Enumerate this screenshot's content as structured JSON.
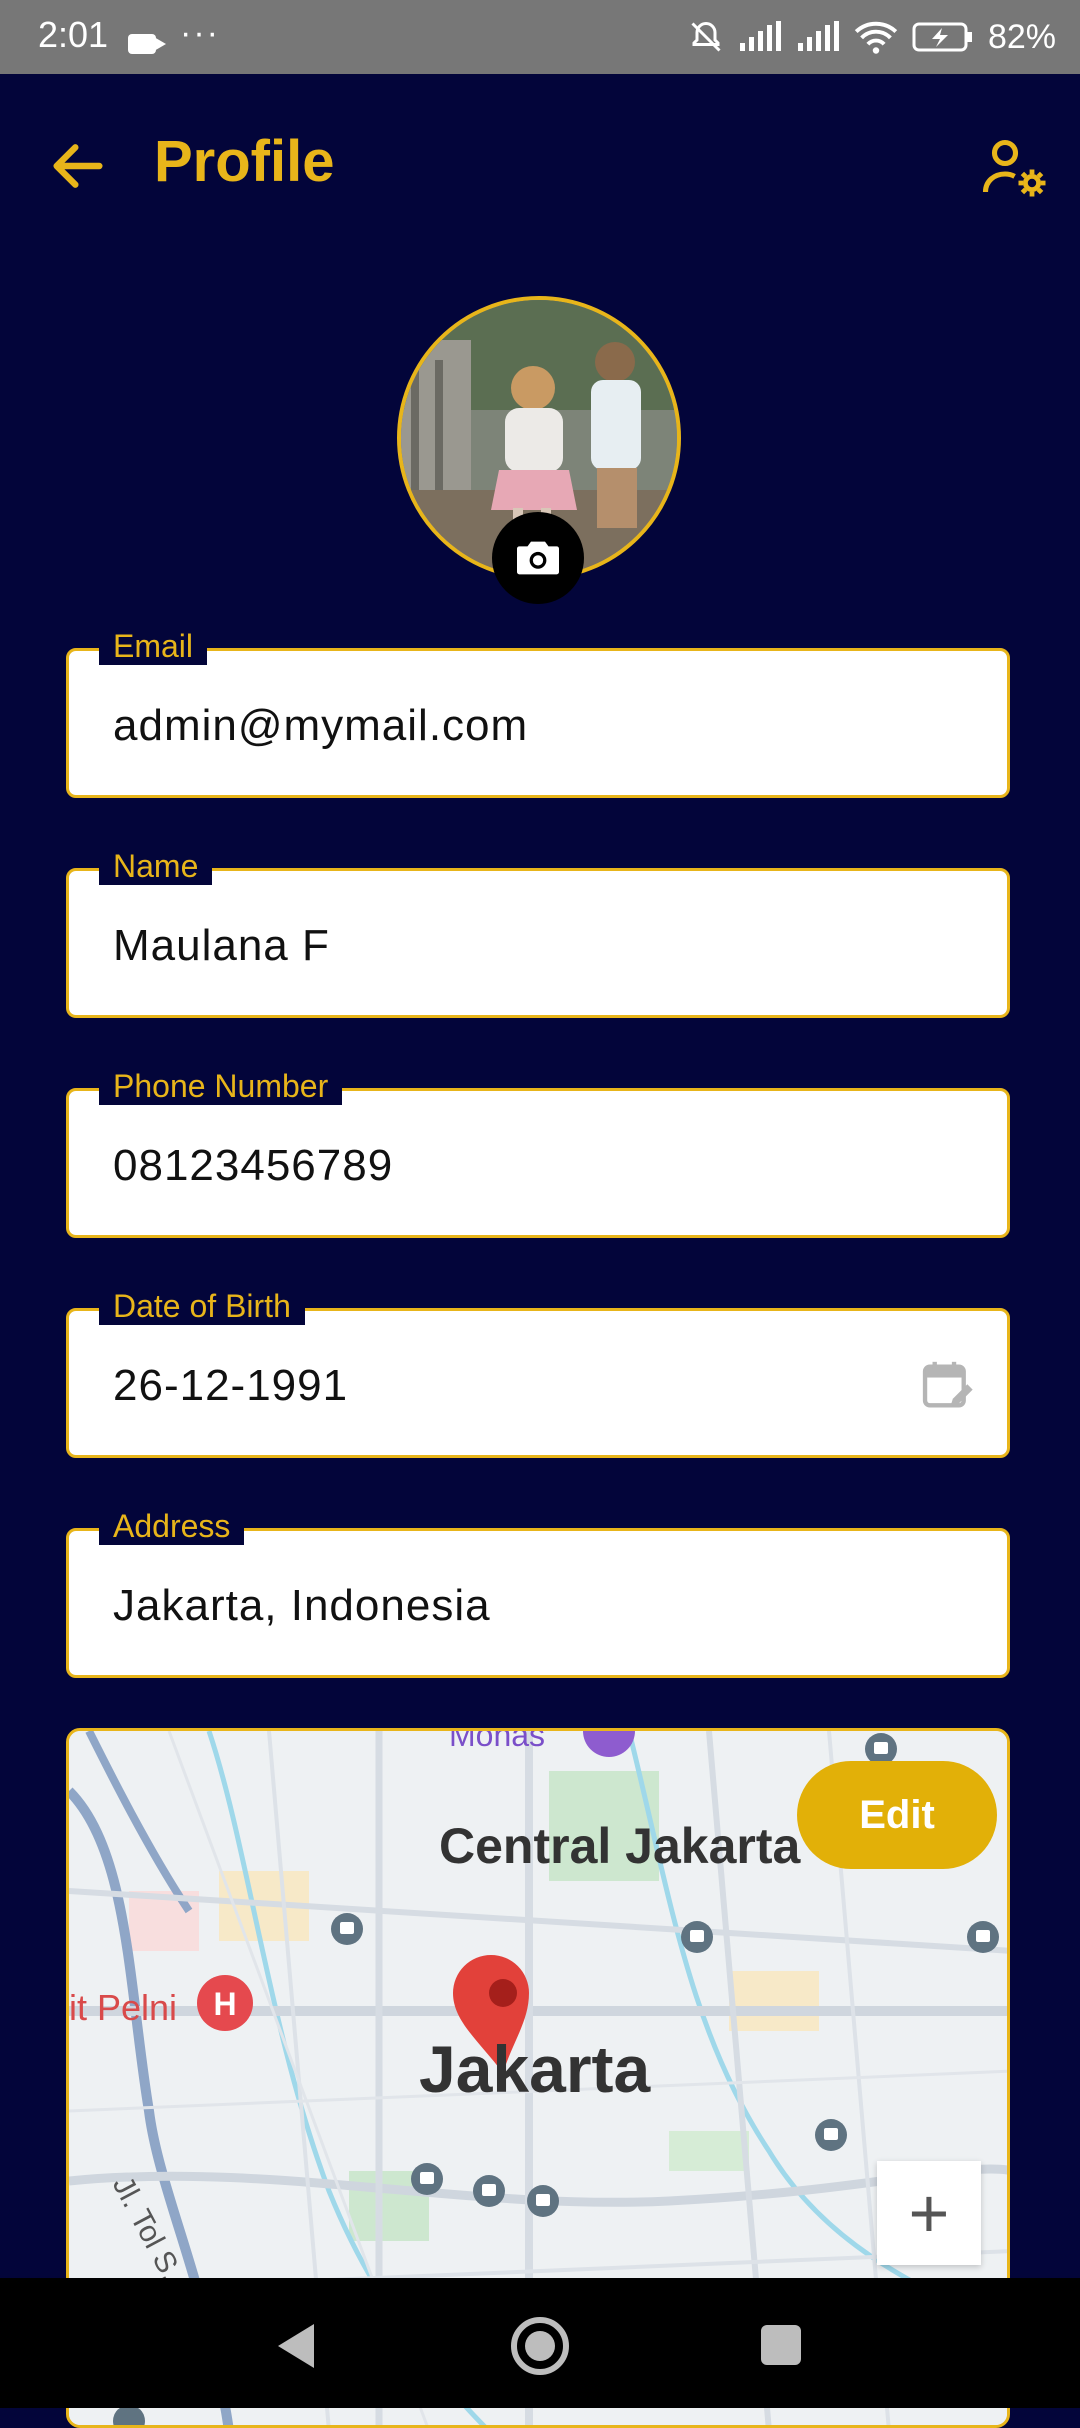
{
  "status_bar": {
    "time": "2:01",
    "dots": "···",
    "battery": "82%"
  },
  "header": {
    "title": "Profile"
  },
  "fields": {
    "email": {
      "label": "Email",
      "value": "admin@mymail.com"
    },
    "name": {
      "label": "Name",
      "value": "Maulana F"
    },
    "phone": {
      "label": "Phone Number",
      "value": "08123456789"
    },
    "dob": {
      "label": "Date of Birth",
      "value": "26-12-1991"
    },
    "address": {
      "label": "Address",
      "value": "Jakarta, Indonesia"
    }
  },
  "map": {
    "label_central": "Central Jakarta",
    "label_city": "Jakarta",
    "label_monas": "Monas",
    "label_hospital": "it Pelni",
    "label_road": "Jl. Tol S. Parman",
    "edit_label": "Edit",
    "zoom_label": "+"
  },
  "colors": {
    "background": "#03053a",
    "accent": "#e8b51a",
    "edit_button": "#e2b008"
  }
}
